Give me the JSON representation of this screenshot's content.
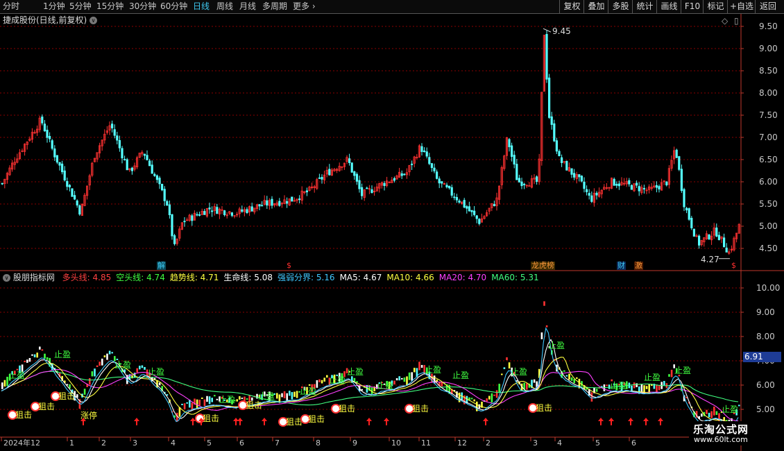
{
  "toolbar": {
    "periods": [
      "分时",
      "1分钟",
      "5分钟",
      "15分钟",
      "30分钟",
      "60分钟",
      "日线",
      "周线",
      "月线",
      "多周期",
      "更多"
    ],
    "active_period": "日线",
    "right_buttons": [
      "复权",
      "叠加",
      "多股",
      "统计",
      "画线",
      "F10",
      "标记",
      "+自选",
      "返回"
    ]
  },
  "main_panel": {
    "title": "捷成股份(日线,前复权)",
    "axis_labels": [
      "9.50",
      "9.00",
      "8.50",
      "8.00",
      "7.50",
      "7.00",
      "6.50",
      "6.00",
      "5.50",
      "5.00",
      "4.50"
    ],
    "high_label": "9.45",
    "low_label": "4.27",
    "markers": [
      {
        "text": "解",
        "color": "#3ec8f0"
      },
      {
        "text": "$",
        "color": "#ff3030"
      },
      {
        "text": "龙虎榜",
        "color": "#ff9a3c"
      },
      {
        "text": "财",
        "color": "#3ec8f0"
      },
      {
        "text": "激",
        "color": "#ff9a3c"
      },
      {
        "text": "$",
        "color": "#ff3030"
      }
    ]
  },
  "indicator_panel": {
    "title": "股朋指标网",
    "values": [
      {
        "label": "多头线:",
        "value": "4.85",
        "color": "#ff4040"
      },
      {
        "label": "空头线:",
        "value": "4.74",
        "color": "#40ff40"
      },
      {
        "label": "趋势线:",
        "value": "4.71",
        "color": "#ffff40"
      },
      {
        "label": "生命线:",
        "value": "5.08",
        "color": "#ffffff"
      },
      {
        "label": "强弱分界:",
        "value": "5.16",
        "color": "#40c8ff"
      },
      {
        "label": "MA5:",
        "value": "4.67",
        "color": "#ffffff"
      },
      {
        "label": "MA10:",
        "value": "4.66",
        "color": "#ffff40"
      },
      {
        "label": "MA20:",
        "value": "4.70",
        "color": "#ff40ff"
      },
      {
        "label": "MA60:",
        "value": "5.31",
        "color": "#40ff80"
      }
    ],
    "axis_labels": [
      "10.00",
      "9.00",
      "8.00",
      "7.00",
      "6.00",
      "5.00"
    ],
    "current_value": "6.91",
    "tags": {
      "stop_profit": "止盈",
      "strike": "狙击",
      "limit_up": "涨停"
    }
  },
  "time_axis": [
    "2024年12",
    "1",
    "2",
    "3",
    "4",
    "5",
    "6",
    "7",
    "8",
    "9",
    "10",
    "11",
    "12",
    "2",
    "3",
    "4",
    "5",
    "6"
  ],
  "watermark": {
    "name": "乐淘公式网",
    "url": "www.60lt.com"
  },
  "colors": {
    "up": "#ff3232",
    "down": "#54ffff",
    "grid": "#8b0000",
    "axis": "#c0392b"
  }
}
